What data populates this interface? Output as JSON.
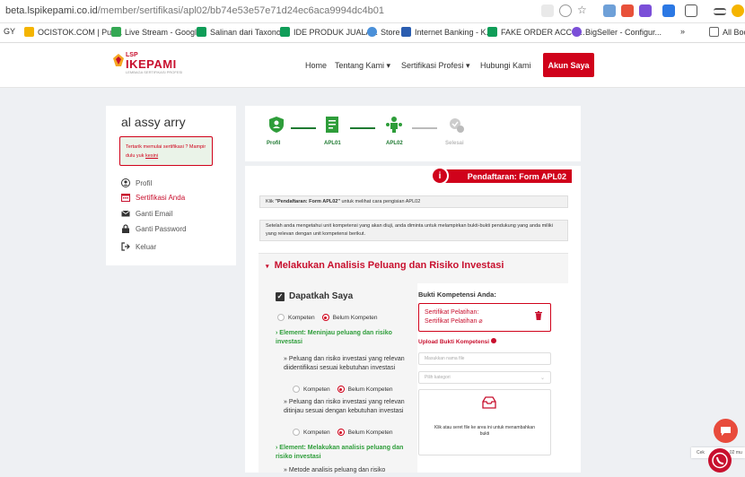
{
  "browser": {
    "url_host": "beta.lspikepami.co.id",
    "url_path": "/member/sertifikasi/apl02/bb74e53e57e71d24ec6aca9994dc4b01",
    "bookmarks": [
      "GY",
      "OCISTOK.COM | Pus...",
      "Live Stream - Googl...",
      "Salinan dari Taxono...",
      "IDE PRODUK JUALA...",
      "Store",
      "Internet Banking - K...",
      "FAKE ORDER ACCO...",
      "BigSeller - Configur..."
    ],
    "bookmarks_more": "»",
    "all_bookmarks": "All Bool"
  },
  "site": {
    "logo_top": "LSP",
    "logo_main": "IKEPAMI",
    "logo_sub": "LEMBAGA SERTIFIKASI PROFESI",
    "nav": [
      "Home",
      "Tentang Kami ▾",
      "Sertifikasi Profesi ▾",
      "Hubungi Kami"
    ],
    "akun_label": "Akun Saya"
  },
  "sidebar": {
    "user_name": "al assy arry",
    "notice_text": "Tertarik memulai sertifikasi ? Mampir dulu yuk",
    "notice_link": "kesini",
    "items": [
      "Profil",
      "Sertifikasi Anda",
      "Ganti Email",
      "Ganti Password",
      "Keluar"
    ]
  },
  "stepper": {
    "steps": [
      "Profil",
      "APL01",
      "APL02",
      "Selesai"
    ]
  },
  "form": {
    "ribbon_icon": "i",
    "ribbon_label": "Pendaftaran: Form APL02",
    "info1_prefix": "Klik ",
    "info1_bold": "\"Pendaftaran: Form APL02\"",
    "info1_suffix": " untuk melihat cara pengisian APL02",
    "info2": "Setelah anda mengetahui unit kompetensi yang akan diuji, anda diminta untuk melampirkan bukti-bukti pendukung yang anda miliki yang relevan dengan unit kompetensi berikut.",
    "section_title": "Melakukan Analisis Peluang dan Risiko Investasi",
    "section_caret": "▾",
    "dapatkah": "Dapatkah Saya",
    "kompeten": "Kompeten",
    "belum_kompeten": "Belum Kompeten",
    "element1": "› Element: Meninjau peluang dan risiko investasi",
    "kuk1": "» Peluang dan risiko investasi yang relevan diidentifikasi sesuai kebutuhan investasi",
    "kuk2": "» Peluang dan risiko investasi yang relevan ditinjau sesuai dengan kebutuhan investasi",
    "element2": "› Element: Melakukan analisis peluang dan risiko investasi",
    "kuk3": "» Metode analisis peluang dan risiko"
  },
  "bukti": {
    "title": "Bukti Kompetensi Anda:",
    "sert_line1": "Sertifikat Pelatihan:",
    "sert_line2": "Sertifikat Pelatihan",
    "upload_label": "Upload Bukti Kompetensi",
    "file_placeholder": "Masukkan nama file",
    "kategori_placeholder": "Pilih kategori",
    "kategori_chevron": "⌄",
    "drop_text": "Klik atau seret file ke area ini untuk menambahkan bukti"
  },
  "widgets": {
    "cek_text": "Cek",
    "cek_text2": "02 mu"
  },
  "colors": {
    "brand_red": "#d0021b",
    "green": "#2e9d3a"
  }
}
